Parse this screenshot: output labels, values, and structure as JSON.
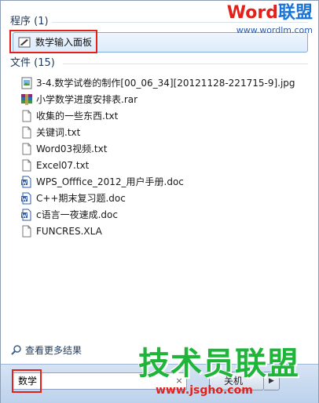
{
  "programs_section": {
    "title": "程序 (1)"
  },
  "program_item": {
    "label": "数学输入面板",
    "icon": "math-input-panel-icon"
  },
  "files_section": {
    "title": "文件 (15)"
  },
  "files": [
    {
      "name": "3-4.数学试卷的制作[00_06_34][20121128-221715-9].jpg",
      "icon": "image-file-icon"
    },
    {
      "name": "小学数学进度安排表.rar",
      "icon": "rar-file-icon"
    },
    {
      "name": "收集的一些东西.txt",
      "icon": "text-file-icon"
    },
    {
      "name": "关键词.txt",
      "icon": "text-file-icon"
    },
    {
      "name": "Word03视频.txt",
      "icon": "text-file-icon"
    },
    {
      "name": "Excel07.txt",
      "icon": "text-file-icon"
    },
    {
      "name": "WPS_Offfice_2012_用户手册.doc",
      "icon": "doc-file-icon"
    },
    {
      "name": "C++期末复习题.doc",
      "icon": "doc-file-icon"
    },
    {
      "name": "c语言一夜速成.doc",
      "icon": "doc-file-icon"
    },
    {
      "name": "FUNCRES.XLA",
      "icon": "blank-file-icon"
    }
  ],
  "see_more": {
    "label": "查看更多结果",
    "icon": "search-icon"
  },
  "search": {
    "value": "数学",
    "clear_symbol": "×"
  },
  "shutdown": {
    "label": "关机",
    "arrow": "▶"
  },
  "watermark_top": {
    "brand_red": "Word",
    "brand_blue": "联盟",
    "url": "www.wordlm.com"
  },
  "watermark_bottom": {
    "brand": "技术员联盟",
    "url": "www.jsgho.com"
  },
  "colors": {
    "accent_blue": "#1e395b",
    "highlight_red": "#e3201a",
    "selection_blue": "#84acdd"
  }
}
